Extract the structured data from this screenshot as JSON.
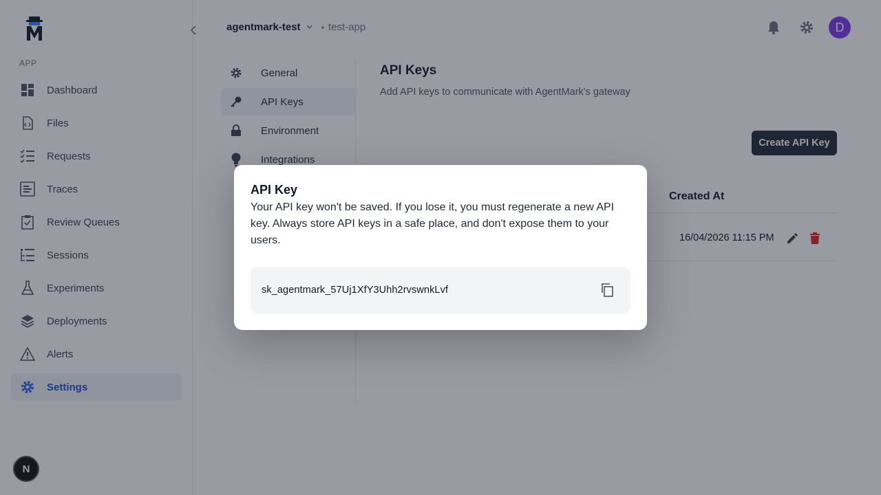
{
  "sidebar": {
    "section_label": "APP",
    "items": [
      {
        "label": "Dashboard",
        "icon": "dashboard-icon"
      },
      {
        "label": "Files",
        "icon": "file-code-icon"
      },
      {
        "label": "Requests",
        "icon": "list-check-icon"
      },
      {
        "label": "Traces",
        "icon": "traces-icon"
      },
      {
        "label": "Review Queues",
        "icon": "clipboard-check-icon"
      },
      {
        "label": "Sessions",
        "icon": "sessions-icon"
      },
      {
        "label": "Experiments",
        "icon": "flask-icon"
      },
      {
        "label": "Deployments",
        "icon": "layers-icon"
      },
      {
        "label": "Alerts",
        "icon": "warning-icon"
      },
      {
        "label": "Settings",
        "icon": "gear-icon",
        "active": true
      }
    ],
    "badge": "N"
  },
  "header": {
    "org": "agentmark-test",
    "app": "test-app",
    "avatar_initial": "D"
  },
  "settings_nav": [
    {
      "label": "General",
      "icon": "gear-icon"
    },
    {
      "label": "API Keys",
      "icon": "key-icon",
      "active": true
    },
    {
      "label": "Environment",
      "icon": "lock-icon"
    },
    {
      "label": "Integrations",
      "icon": "bulb-icon"
    }
  ],
  "main": {
    "title": "API Keys",
    "description": "Add API keys to communicate with AgentMark's gateway",
    "create_button": "Create API Key",
    "table": {
      "created_header": "Created At",
      "rows": [
        {
          "created_at": "16/04/2026 11:15 PM"
        }
      ]
    }
  },
  "modal": {
    "title": "API Key",
    "body": "Your API key won't be saved. If you lose it, you must regenerate a new API key. Always store API keys in a safe place, and don't expose them to your users.",
    "key": "sk_agentmark_57Uj1XfY3Uhh2rvswnkLvf"
  },
  "colors": {
    "accent": "#2563eb",
    "avatar": "#7c3aed",
    "button_dark": "#1f2937",
    "danger": "#dc2626"
  }
}
